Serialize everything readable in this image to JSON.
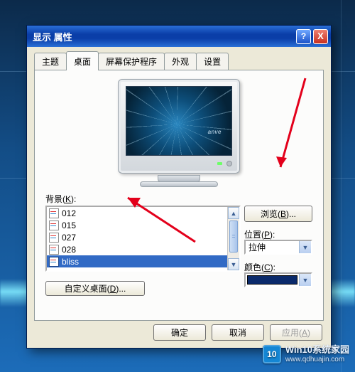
{
  "window": {
    "title": "显示 属性",
    "help": "?",
    "close": "X"
  },
  "tabs": {
    "theme": "主题",
    "desktop": "桌面",
    "screensaver": "屏幕保护程序",
    "appearance": "外观",
    "settings": "设置"
  },
  "preview": {
    "brand": "anve"
  },
  "background": {
    "label_prefix": "背景(",
    "label_u": "K",
    "label_suffix": "):",
    "items": [
      "012",
      "015",
      "027",
      "028",
      "bliss"
    ],
    "selected_index": 4
  },
  "browse": {
    "prefix": "浏览(",
    "u": "B",
    "suffix": ")..."
  },
  "position": {
    "label_prefix": "位置(",
    "label_u": "P",
    "label_suffix": "):",
    "value": "拉伸"
  },
  "color": {
    "label_prefix": "颜色(",
    "label_u": "C",
    "label_suffix": "):",
    "value_hex": "#0a2a6b"
  },
  "custom": {
    "prefix": "自定义桌面(",
    "u": "D",
    "suffix": ")..."
  },
  "buttons": {
    "ok": "确定",
    "cancel": "取消",
    "apply_prefix": "应用(",
    "apply_u": "A",
    "apply_suffix": ")"
  },
  "scroll": {
    "up": "▲",
    "down": "▼"
  },
  "dd": "▼",
  "watermark": {
    "logo": "10",
    "line1": "Win10系统家园",
    "line2": "www.qdhuajin.com"
  }
}
